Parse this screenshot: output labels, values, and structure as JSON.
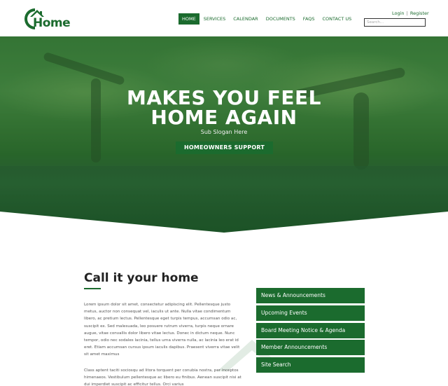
{
  "header": {
    "logo_text": "Home",
    "nav": [
      {
        "label": "HOME",
        "active": true
      },
      {
        "label": "SERVICES",
        "active": false
      },
      {
        "label": "CALENDAR",
        "active": false
      },
      {
        "label": "DOCUMENTS",
        "active": false
      },
      {
        "label": "FAQS",
        "active": false
      },
      {
        "label": "CONTACT US",
        "active": false
      }
    ],
    "login_label": "Login",
    "separator": "|",
    "register_label": "Register",
    "search_placeholder": "Search..."
  },
  "hero": {
    "title_line1": "MAKES YOU FEEL",
    "title_line2": "HOME AGAIN",
    "subtitle": "Sub Slogan Here",
    "button_label": "HOMEOWNERS SUPPORT"
  },
  "content": {
    "title": "Call it your home",
    "paragraph1": "Lorem ipsum dolor sit amet, consectetur adipiscing elit. Pellentesque justo metus, auctor non consequat vel, iaculis ut ante. Nulla vitae condimentum libero, ac pretium lectus. Pellentesque eget turpis tempus, accumsan odio ac, suscipit ex. Sed malesuada, leo posuere rutrum viverra, turpis neque ornare augue, vitae convallis dolor libero vitae lectus. Donec in dictum neque. Nunc tempor, odio nec sodales lacinia, tellus urna viverra nulla, ac lacinia leo erat id eret. Etiam accumsan cursus ipsum iaculis dapibus. Praesent viverra vitae velit sit amet maximus",
    "paragraph2": "Class aptent taciti sociosqu ad litora torquent per conubia nostra, per inceptos himenaeos. Vestibulum pellentesque ac libero eu finibus. Aenean suscipit nisi at dui imperdiet suscipit ac efficitur tellus. Orci varius"
  },
  "side_links": [
    "News & Announcements",
    "Upcoming Events",
    "Board Meeting Notice & Agenda",
    "Member Announcements",
    "Site Search"
  ],
  "colors": {
    "brand_green": "#1b6b2e",
    "text_dark": "#222222"
  }
}
